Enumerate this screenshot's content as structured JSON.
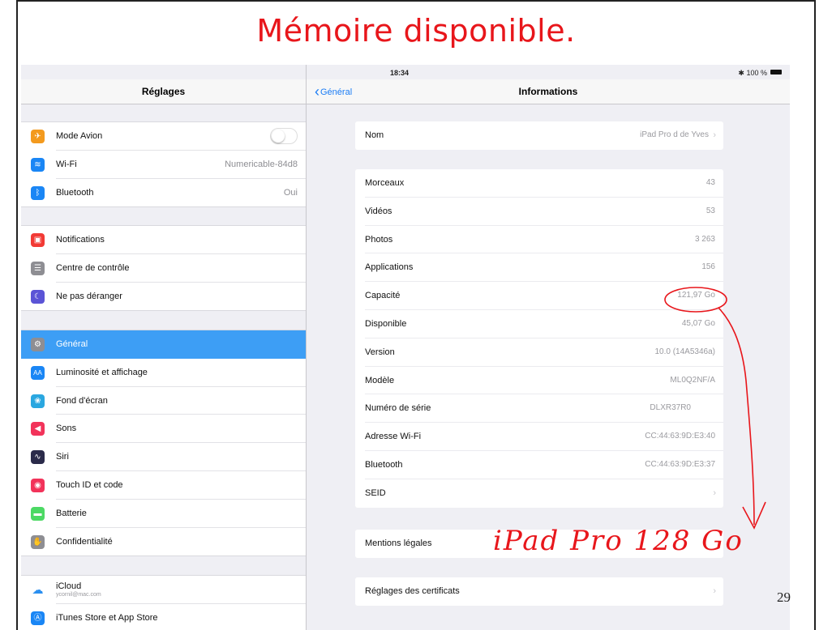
{
  "slide": {
    "title": "Mémoire disponible.",
    "page_number": "29"
  },
  "status_bar": {
    "device": "iPad",
    "time": "18:34",
    "battery": "100 %"
  },
  "settings": {
    "header": "Réglages",
    "group1": [
      {
        "label": "Mode Avion",
        "icon": "airplane-icon",
        "color": "#f39a1e",
        "toggle": "off"
      },
      {
        "label": "Wi-Fi",
        "icon": "wifi-icon",
        "color": "#1a86f5",
        "value": "Numericable-84d8"
      },
      {
        "label": "Bluetooth",
        "icon": "bluetooth-icon",
        "color": "#1a86f5",
        "value": "Oui"
      }
    ],
    "group2": [
      {
        "label": "Notifications",
        "icon": "notifications-icon",
        "color": "#f23a35"
      },
      {
        "label": "Centre de contrôle",
        "icon": "control-center-icon",
        "color": "#8e8e93"
      },
      {
        "label": "Ne pas déranger",
        "icon": "moon-icon",
        "color": "#5b54d6"
      }
    ],
    "group3": [
      {
        "label": "Général",
        "icon": "gear-icon",
        "color": "#8e8e93",
        "selected": true
      },
      {
        "label": "Luminosité et affichage",
        "icon": "display-icon",
        "color": "#1a86f5"
      },
      {
        "label": "Fond d'écran",
        "icon": "wallpaper-icon",
        "color": "#2aa7e0"
      },
      {
        "label": "Sons",
        "icon": "sound-icon",
        "color": "#f2335a"
      },
      {
        "label": "Siri",
        "icon": "siri-icon",
        "color": "#2b2b4a"
      },
      {
        "label": "Touch ID et code",
        "icon": "fingerprint-icon",
        "color": "#f2335a"
      },
      {
        "label": "Batterie",
        "icon": "battery-icon",
        "color": "#4cd964"
      },
      {
        "label": "Confidentialité",
        "icon": "hand-icon",
        "color": "#8e8e93"
      }
    ],
    "group4": [
      {
        "label": "iCloud",
        "sub": "ycornil@mac.com",
        "icon": "cloud-icon",
        "color": "#ffffff"
      },
      {
        "label": "iTunes Store et App Store",
        "icon": "app-store-icon",
        "color": "#1a86f5"
      }
    ]
  },
  "info": {
    "back_label": "Général",
    "title": "Informations",
    "nom": {
      "label": "Nom",
      "value": "iPad Pro d de Yves"
    },
    "details": [
      {
        "label": "Morceaux",
        "value": "43"
      },
      {
        "label": "Vidéos",
        "value": "53"
      },
      {
        "label": "Photos",
        "value": "3 263"
      },
      {
        "label": "Applications",
        "value": "156"
      },
      {
        "label": "Capacité",
        "value": "121,97 Go"
      },
      {
        "label": "Disponible",
        "value": "45,07 Go"
      },
      {
        "label": "Version",
        "value": "10.0 (14A5346a)"
      },
      {
        "label": "Modèle",
        "value": "ML0Q2NF/A"
      },
      {
        "label": "Numéro de série",
        "value": "DLXR37R0"
      },
      {
        "label": "Adresse Wi-Fi",
        "value": "CC:44:63:9D:E3:40"
      },
      {
        "label": "Bluetooth",
        "value": "CC:44:63:9D:E3:37"
      },
      {
        "label": "SEID",
        "value": ""
      }
    ],
    "mentions": {
      "label": "Mentions légales"
    },
    "certs": {
      "label": "Réglages des certificats"
    }
  },
  "annotation": {
    "handwritten": "iPad Pro 128 Go",
    "color": "#e8161b"
  }
}
